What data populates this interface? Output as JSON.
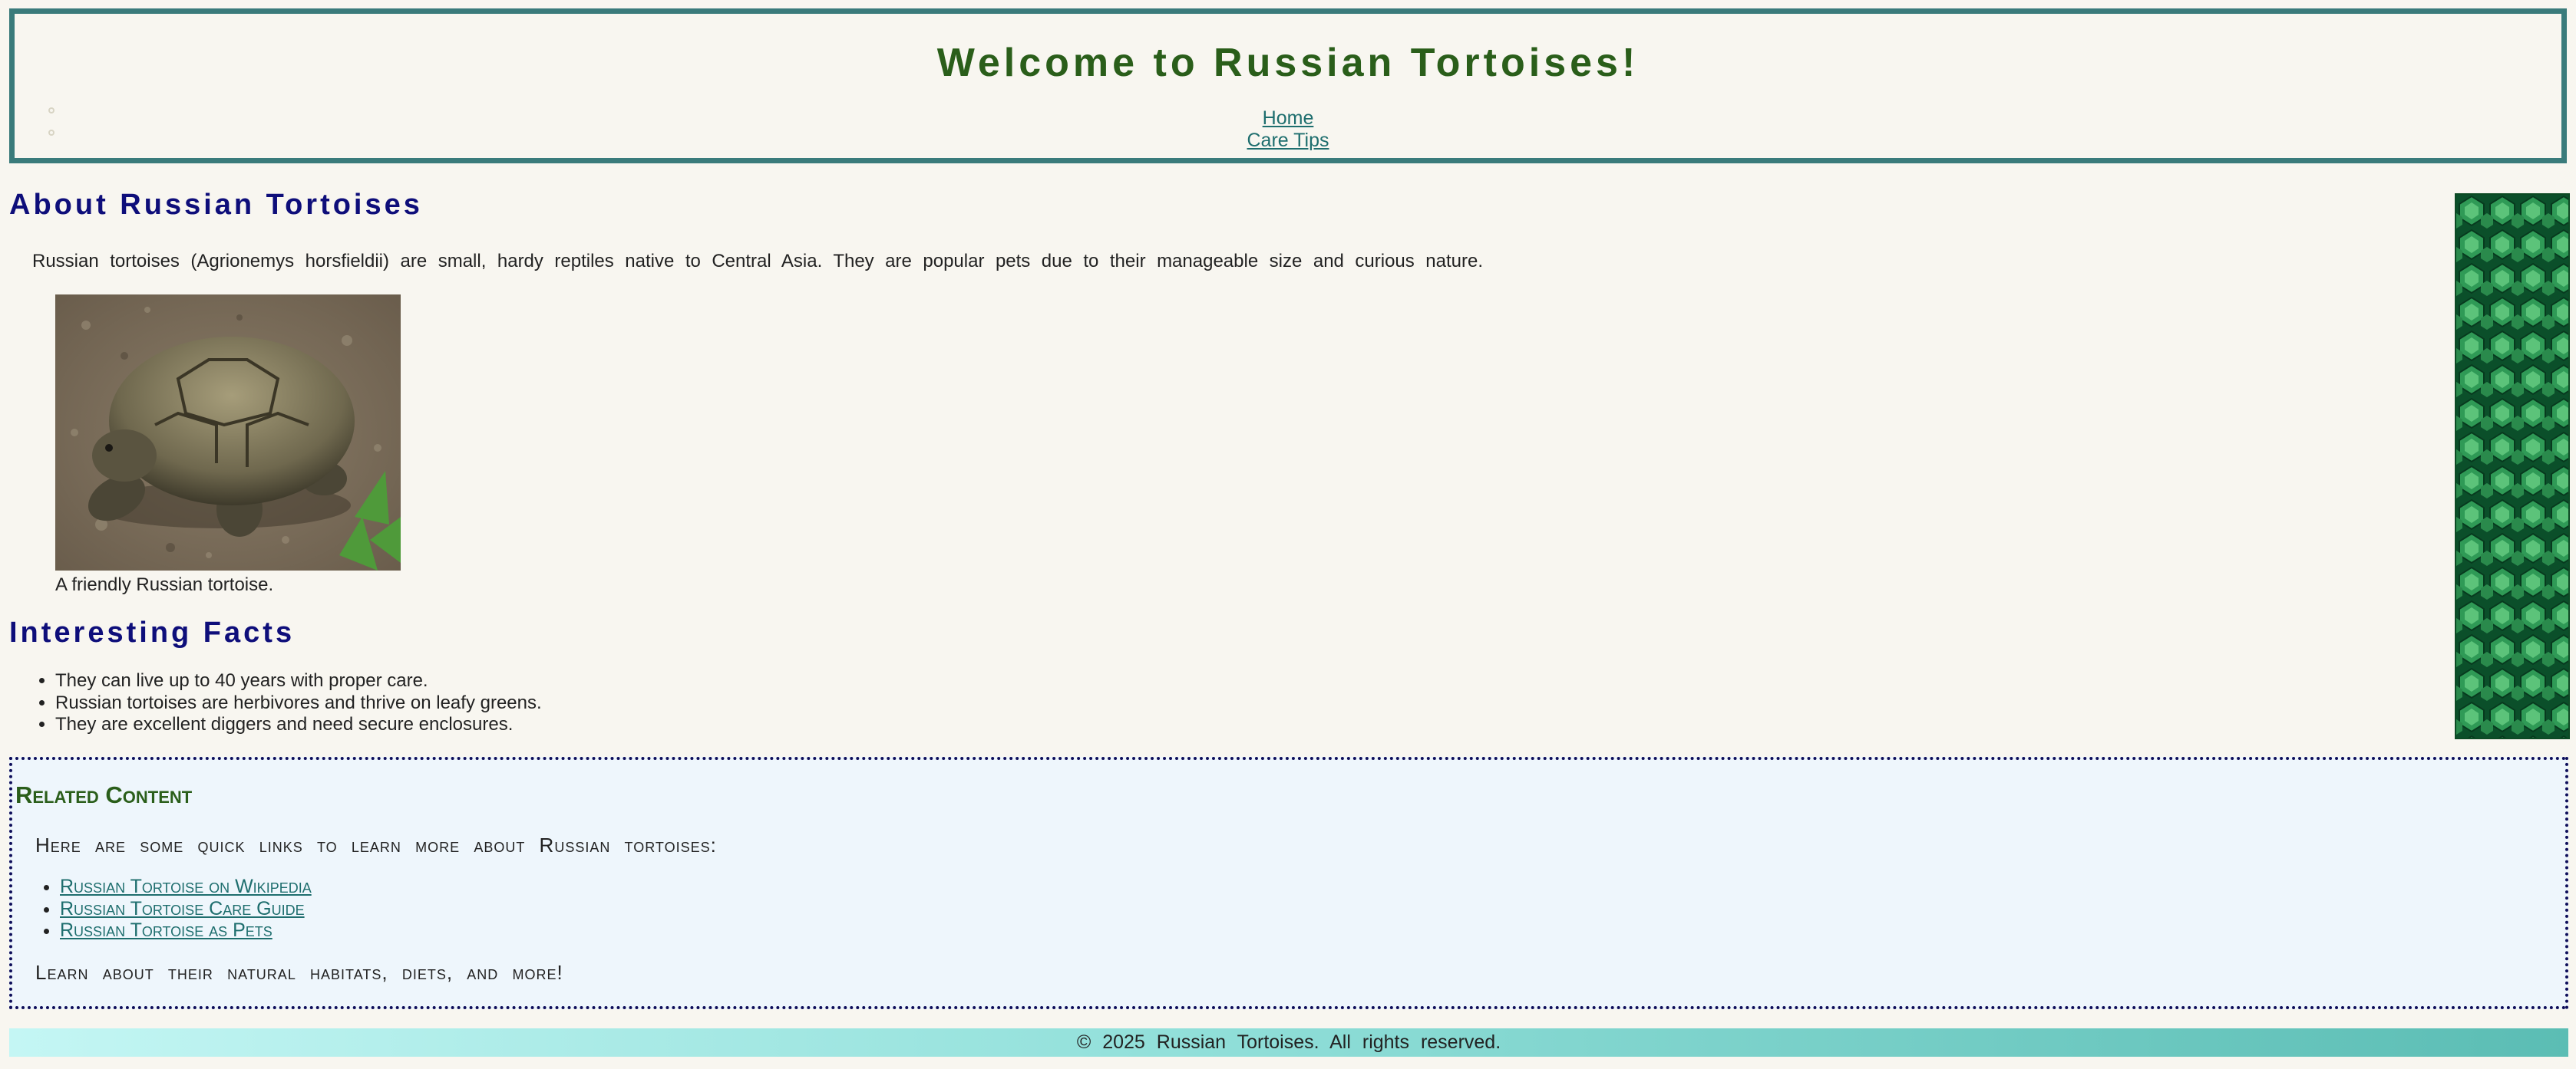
{
  "header": {
    "title": "Welcome to Russian Tortoises!",
    "nav": [
      {
        "label": "Home"
      },
      {
        "label": "Care Tips"
      }
    ]
  },
  "about": {
    "heading": "About Russian Tortoises",
    "intro": "Russian tortoises (Agrionemys horsfieldii) are small, hardy reptiles native to Central Asia. They are popular pets due to their manageable size and curious nature.",
    "image_caption": "A friendly Russian tortoise."
  },
  "facts": {
    "heading": "Interesting Facts",
    "items": [
      "They can live up to 40 years with proper care.",
      "Russian tortoises are herbivores and thrive on leafy greens.",
      "They are excellent diggers and need secure enclosures."
    ]
  },
  "related": {
    "heading": "Related Content",
    "lead": "Here are some quick links to learn more about Russian tortoises:",
    "links": [
      "Russian Tortoise on Wikipedia",
      "Russian Tortoise Care Guide",
      "Russian Tortoise as Pets"
    ],
    "tail": "Learn about their natural habitats, diets, and more!"
  },
  "footer": {
    "text": "© 2025 Russian Tortoises. All rights reserved."
  },
  "colors": {
    "title_green": "#2a5e1a",
    "heading_navy": "#0e0e7a",
    "link_teal": "#1e6e6e",
    "header_border": "#3a7b7b",
    "background": "#f8f6f0",
    "related_background": "#eef6fc"
  }
}
